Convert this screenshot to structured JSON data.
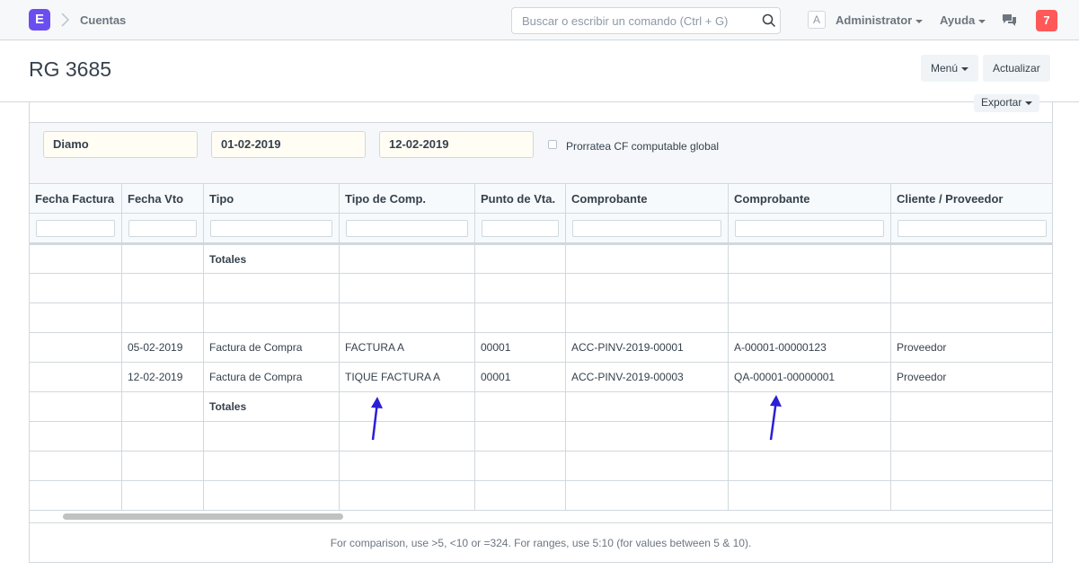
{
  "navbar": {
    "logo_letter": "E",
    "breadcrumb": "Cuentas",
    "search_placeholder": "Buscar o escribir un comando (Ctrl + G)",
    "avatar_letter": "A",
    "user_label": "Administrator",
    "help_label": "Ayuda",
    "notification_count": "7"
  },
  "page": {
    "title": "RG 3685",
    "menu_label": "Menú",
    "refresh_label": "Actualizar",
    "export_label": "Exportar"
  },
  "filters": {
    "company": "Diamo",
    "from_date": "01-02-2019",
    "to_date": "12-02-2019",
    "checkbox_label": "Prorratea CF computable global"
  },
  "table": {
    "columns": [
      "Fecha Factura",
      "Fecha Vto",
      "Tipo",
      "Tipo de Comp.",
      "Punto de Vta.",
      "Comprobante",
      "Comprobante",
      "Cliente / Proveedor"
    ],
    "rows": [
      [
        "",
        "",
        "Totales",
        "",
        "",
        "",
        "",
        ""
      ],
      [
        "",
        "",
        "",
        "",
        "",
        "",
        "",
        ""
      ],
      [
        "",
        "",
        "",
        "",
        "",
        "",
        "",
        ""
      ],
      [
        "",
        "05-02-2019",
        "Factura de Compra",
        "FACTURA A",
        "00001",
        "ACC-PINV-2019-00001",
        "A-00001-00000123",
        "Proveedor"
      ],
      [
        "",
        "12-02-2019",
        "Factura de Compra",
        "TIQUE FACTURA A",
        "00001",
        "ACC-PINV-2019-00003",
        "QA-00001-00000001",
        "Proveedor"
      ],
      [
        "",
        "",
        "Totales",
        "",
        "",
        "",
        "",
        ""
      ],
      [
        "",
        "",
        "",
        "",
        "",
        "",
        "",
        ""
      ],
      [
        "",
        "",
        "",
        "",
        "",
        "",
        "",
        ""
      ],
      [
        "",
        "",
        "",
        "",
        "",
        "",
        "",
        ""
      ]
    ]
  },
  "footer_note": "For comparison, use >5, <10 or =324. For ranges, use 5:10 (for values between 5 & 10).",
  "colors": {
    "brand": "#6c4ef0",
    "notification": "#ff5858",
    "annotation_arrow": "#2b1fd6"
  }
}
